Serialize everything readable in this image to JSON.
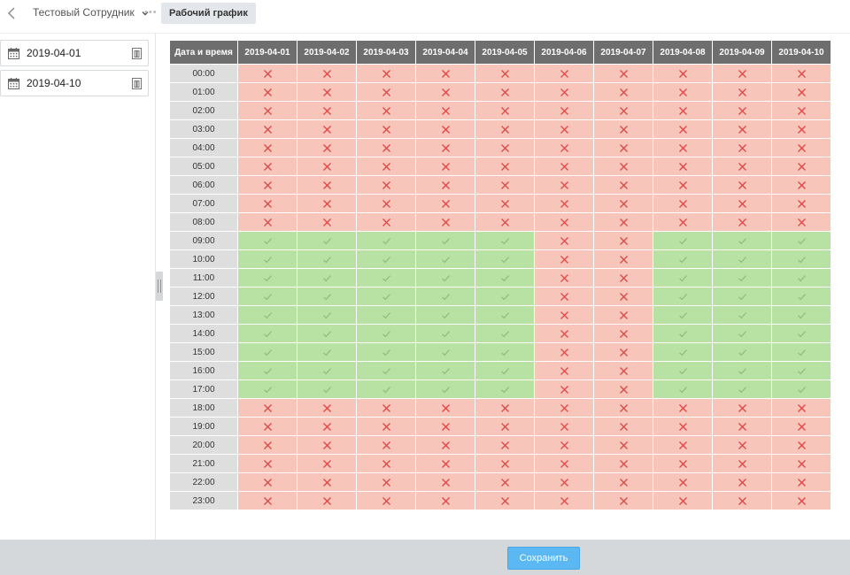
{
  "header": {
    "employee_name": "Тестовый Сотрудник",
    "active_tab": "Рабочий график"
  },
  "sidebar": {
    "dates": [
      "2019-04-01",
      "2019-04-10"
    ]
  },
  "schedule": {
    "corner_label": "Дата и время",
    "days": [
      "2019-04-01",
      "2019-04-02",
      "2019-04-03",
      "2019-04-04",
      "2019-04-05",
      "2019-04-06",
      "2019-04-07",
      "2019-04-08",
      "2019-04-09",
      "2019-04-10"
    ],
    "hours": [
      "00:00",
      "01:00",
      "02:00",
      "03:00",
      "04:00",
      "05:00",
      "06:00",
      "07:00",
      "08:00",
      "09:00",
      "10:00",
      "11:00",
      "12:00",
      "13:00",
      "14:00",
      "15:00",
      "16:00",
      "17:00",
      "18:00",
      "19:00",
      "20:00",
      "21:00",
      "22:00",
      "23:00"
    ],
    "working_hours": [
      "09:00",
      "10:00",
      "11:00",
      "12:00",
      "13:00",
      "14:00",
      "15:00",
      "16:00",
      "17:00"
    ],
    "working_days": [
      "2019-04-01",
      "2019-04-02",
      "2019-04-03",
      "2019-04-04",
      "2019-04-05",
      "2019-04-08",
      "2019-04-09",
      "2019-04-10"
    ],
    "colors": {
      "available": "#b7e2a4",
      "unavailable": "#f7c5ba",
      "check_mark": "#8fc07c",
      "cross_mark": "#e04545",
      "header_bg": "#6e6e6e"
    }
  },
  "icons": {
    "back": "chevron-left-icon",
    "dropdown": "chevron-down-icon",
    "calendar": "calendar-icon",
    "delete": "trash-icon",
    "available": "check-icon",
    "unavailable": "cross-icon"
  },
  "footer": {
    "save_label": "Сохранить"
  }
}
